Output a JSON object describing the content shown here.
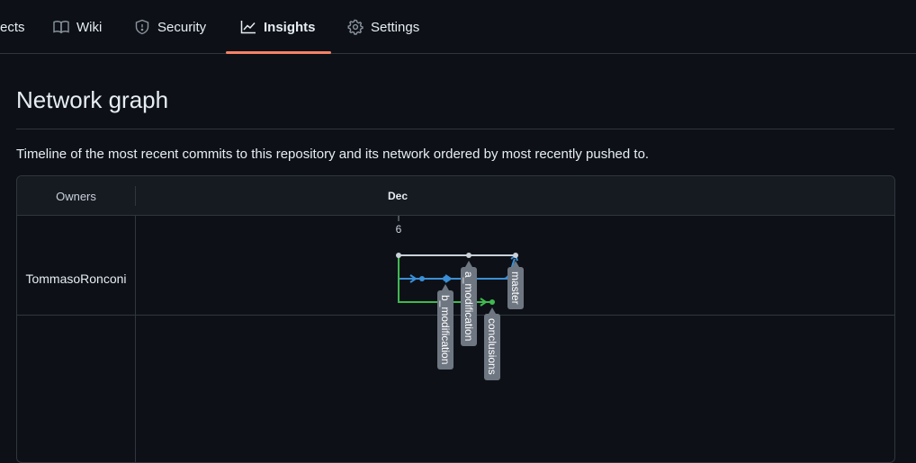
{
  "nav": {
    "tabs": [
      {
        "label": "ects",
        "icon": "project-icon"
      },
      {
        "label": "Wiki",
        "icon": "book-icon"
      },
      {
        "label": "Security",
        "icon": "shield-icon"
      },
      {
        "label": "Insights",
        "icon": "graph-icon",
        "selected": true
      },
      {
        "label": "Settings",
        "icon": "gear-icon"
      }
    ]
  },
  "page": {
    "title": "Network graph",
    "description": "Timeline of the most recent commits to this repository and its network ordered by most recently pushed to."
  },
  "graph": {
    "owners_header": "Owners",
    "month": "Dec",
    "day": "6",
    "owner": "TommasoRonconi",
    "branches": {
      "master": "master",
      "a_modification": "a_modification",
      "b_modification": "b_modification",
      "conclusions": "conclusions"
    },
    "colors": {
      "master": "#c9d1d9",
      "blue_branch": "#3b8fd6",
      "green_branch": "#3fb950",
      "label_bg": "#6e7681",
      "accent_underline": "#f78166"
    }
  }
}
